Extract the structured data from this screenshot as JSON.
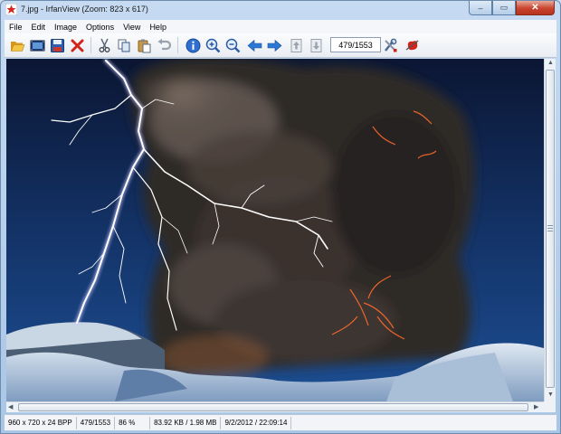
{
  "window": {
    "title": "7.jpg - IrfanView (Zoom: 823 x 617)",
    "buttons": {
      "minimize": "–",
      "maximize": "▭",
      "close": "✕"
    }
  },
  "menu": [
    "File",
    "Edit",
    "Image",
    "Options",
    "View",
    "Help"
  ],
  "toolbar": {
    "page_indicator": "479/1553",
    "icons": [
      "open-folder-icon",
      "slideshow-icon",
      "save-icon",
      "delete-icon",
      "cut-icon",
      "copy-icon",
      "paste-icon",
      "undo-icon",
      "info-icon",
      "zoom-in-icon",
      "zoom-out-icon",
      "previous-arrow-icon",
      "next-arrow-icon",
      "first-file-icon",
      "last-file-icon",
      "settings-icon",
      "exit-icon"
    ]
  },
  "status": {
    "dimensions": "960 x 720 x 24 BPP",
    "index": "479/1553",
    "zoom": "86 %",
    "size": "83.92 KB / 1.98 MB",
    "date": "9/2/2012 / 22:09:14"
  },
  "image": {
    "subject": "volcano-eruption-lightning-photo",
    "colors": {
      "sky": "#14356b",
      "plume": "#2f2a27",
      "lightning": "#f0eaff",
      "ice": "#cfdbe8"
    }
  }
}
